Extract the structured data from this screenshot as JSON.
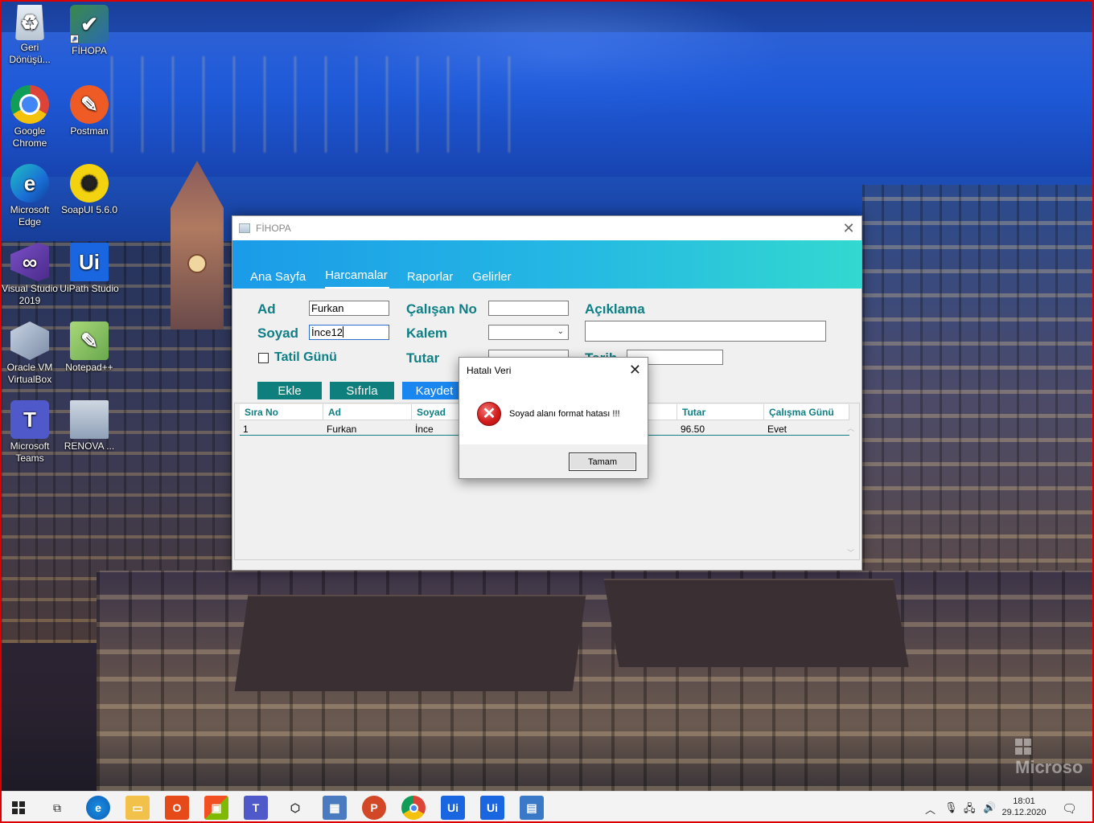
{
  "desktop": {
    "icons": [
      {
        "label": "Geri Dönüşü...",
        "icon": "recycle-bin-icon"
      },
      {
        "label": "FİHOPA",
        "icon": "fihopa-app-icon"
      },
      {
        "label": "Google Chrome",
        "icon": "chrome-icon"
      },
      {
        "label": "Postman",
        "icon": "postman-icon"
      },
      {
        "label": "Microsoft Edge",
        "icon": "edge-icon"
      },
      {
        "label": "SoapUI 5.6.0",
        "icon": "soapui-icon"
      },
      {
        "label": "Visual Studio 2019",
        "icon": "visual-studio-icon"
      },
      {
        "label": "UiPath Studio",
        "icon": "uipath-icon"
      },
      {
        "label": "Oracle VM VirtualBox",
        "icon": "virtualbox-icon"
      },
      {
        "label": "Notepad++",
        "icon": "notepadpp-icon"
      },
      {
        "label": "Microsoft Teams",
        "icon": "teams-icon"
      },
      {
        "label": "RENOVA ...",
        "icon": "renova-icon"
      }
    ],
    "icon_glyphs": {
      "uipath": "Ui",
      "teams": "T"
    },
    "watermark": "Microso"
  },
  "app": {
    "title": "FİHOPA",
    "tabs": [
      {
        "label": "Ana Sayfa",
        "active": false
      },
      {
        "label": "Harcamalar",
        "active": true
      },
      {
        "label": "Raporlar",
        "active": false
      },
      {
        "label": "Gelirler",
        "active": false
      }
    ],
    "form": {
      "ad_label": "Ad",
      "ad_value": "Furkan",
      "soyad_label": "Soyad",
      "soyad_value": "İnce12",
      "tatil_label": "Tatil Günü",
      "tatil_checked": false,
      "calisan_label": "Çalışan No",
      "calisan_value": "",
      "kalem_label": "Kalem",
      "kalem_value": "",
      "tutar_label": "Tutar",
      "tutar_value": "",
      "aciklama_label": "Açıklama",
      "aciklama_value": "",
      "tarih_label": "Tarih",
      "tarih_value": ""
    },
    "buttons": {
      "ekle": "Ekle",
      "sifirla": "Sıfırla",
      "kaydet": "Kaydet"
    },
    "grid": {
      "columns": [
        "Sıra No",
        "Ad",
        "Soyad",
        "",
        "",
        "Tutar",
        "Çalışma Günü"
      ],
      "rows": [
        [
          "1",
          "Furkan",
          "İnce",
          "",
          "",
          "96.50",
          "Evet"
        ]
      ]
    },
    "colors": {
      "accent": "#0e7f84",
      "header_start": "#1b9be8",
      "header_end": "#33d8d0",
      "kaydet": "#1a86f0"
    }
  },
  "dialog": {
    "title": "Hatalı Veri",
    "message": "Soyad alanı format hatası !!!",
    "ok_label": "Tamam",
    "icon": "error-icon"
  },
  "taskbar": {
    "items": [
      "start-icon",
      "task-view-icon",
      "edge-icon",
      "file-explorer-icon",
      "office-icon",
      "store-icon",
      "teams-icon",
      "virtualbox-icon",
      "calculator-icon",
      "powerpoint-icon",
      "chrome-icon",
      "uipath-icon",
      "uipath-robot-icon",
      "app-window-icon"
    ],
    "time": "18:01",
    "date": "29.12.2020",
    "uipath_glyph": "Ui"
  }
}
